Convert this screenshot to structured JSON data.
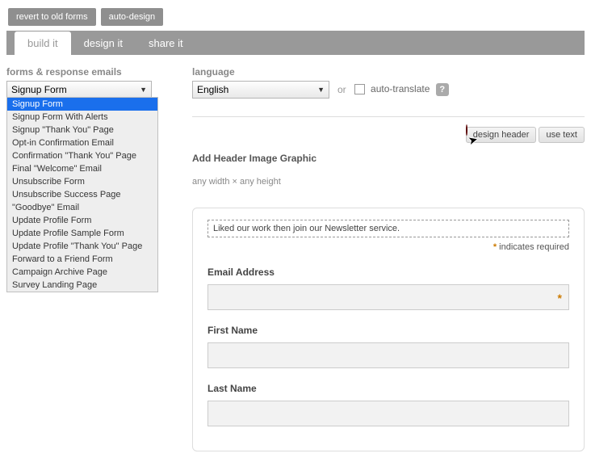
{
  "top": {
    "revert": "revert to old forms",
    "autodesign": "auto-design"
  },
  "tabs": {
    "build": "build it",
    "design": "design it",
    "share": "share it"
  },
  "left": {
    "heading": "forms & response emails",
    "selected": "Signup Form",
    "options": [
      "Signup Form",
      "Signup Form With Alerts",
      "Signup \"Thank You\" Page",
      "Opt-in Confirmation Email",
      "Confirmation \"Thank You\" Page",
      "Final \"Welcome\" Email",
      "Unsubscribe Form",
      "Unsubscribe Success Page",
      "\"Goodbye\" Email",
      "Update Profile Form",
      "Update Profile Sample Form",
      "Update Profile \"Thank You\" Page",
      "Forward to a Friend Form",
      "Campaign Archive Page",
      "Survey Landing Page"
    ]
  },
  "lang": {
    "heading": "language",
    "selected": "English",
    "or": "or",
    "auto": "auto-translate",
    "help": "?"
  },
  "header": {
    "btn_design": "design header",
    "btn_usetext": "use text",
    "title": "Add Header Image Graphic",
    "dims": "any width × any height"
  },
  "form": {
    "intro": "Liked our work then join our Newsletter service.",
    "req": "indicates required",
    "star": "*",
    "f1": "Email Address",
    "f2": "First Name",
    "f3": "Last Name"
  }
}
